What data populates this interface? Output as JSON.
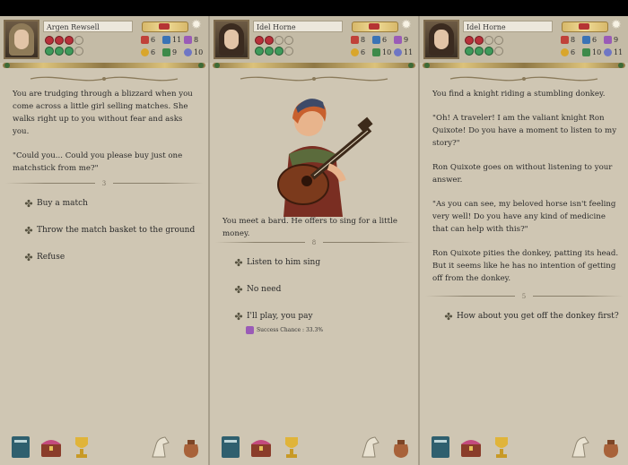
{
  "panels": [
    {
      "character": {
        "name": "Argen Rewsell",
        "hp": [
          1,
          1,
          1,
          0
        ],
        "sp": [
          1,
          1,
          1,
          0
        ]
      },
      "stats": [
        "6",
        "11",
        "8",
        "6",
        "9",
        "10"
      ],
      "story": [
        "You are trudging through a blizzard when you come across a little girl selling matches. She walks right up to you without fear and asks you.",
        "\"Could you... Could you please buy just one matchstick from me?\""
      ],
      "separator": "3",
      "choices": [
        "Buy a match",
        "Throw the match basket to the ground",
        "Refuse"
      ]
    },
    {
      "character": {
        "name": "Idel Horne",
        "hp": [
          1,
          1,
          0,
          0
        ],
        "sp": [
          1,
          1,
          1,
          0
        ]
      },
      "stats": [
        "8",
        "6",
        "9",
        "6",
        "10",
        "11"
      ],
      "story": [
        "You meet a bard. He offers to sing for a little money."
      ],
      "separator": "8",
      "choices": [
        "Listen to him sing",
        "No need",
        "I'll play, you pay"
      ],
      "chance": "Success Chance : 33.3%"
    },
    {
      "character": {
        "name": "Idel Horne",
        "hp": [
          1,
          1,
          0,
          0
        ],
        "sp": [
          1,
          1,
          1,
          0
        ]
      },
      "stats": [
        "8",
        "6",
        "9",
        "6",
        "10",
        "11"
      ],
      "story": [
        "You find a knight riding a stumbling donkey.",
        "\"Oh! A traveler! I am the valiant knight Ron Quixote! Do you have a moment to listen to my story?\"",
        "Ron Quixote goes on without listening to your answer.",
        "\"As you can see, my beloved horse isn't feeling very well! Do you have any kind of medicine that can help with this?\"",
        "Ron Quixote pities the donkey, patting its head. But it seems like he has no intention of getting off from the donkey."
      ],
      "separator": "5",
      "choices": [
        "How about you get off the donkey first?"
      ]
    }
  ],
  "icons": {
    "stats": [
      "fist-icon",
      "boot-icon",
      "hand-icon",
      "coin-icon",
      "heart-icon",
      "eye-icon"
    ],
    "footer": [
      "book-icon",
      "treasure-chest-icon",
      "trophy-icon",
      "horse-icon",
      "bag-icon"
    ]
  }
}
